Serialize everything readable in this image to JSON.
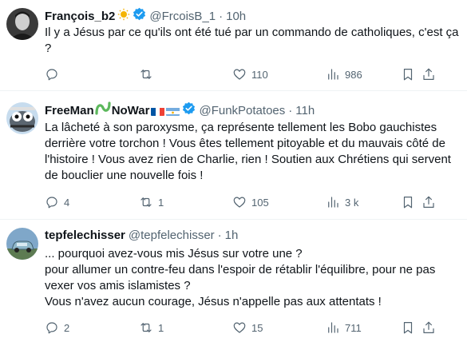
{
  "tweets": [
    {
      "name": "François_b2",
      "handle": "@FrcoisB_1",
      "time": "10h",
      "text": "Il y a Jésus par ce qu'ils ont été tué par un commando de catholiques, c'est ça ?",
      "replies": "",
      "retweets": "",
      "likes": "110",
      "views": "986",
      "badge_color": "#1d9bf0"
    },
    {
      "name": "FreeMan",
      "name_suffix": "NoWar",
      "handle": "@FunkPotatoes",
      "time": "11h",
      "text": "La lâcheté à son paroxysme, ça représente tellement les Bobo gauchistes derrière votre torchon ! Vous êtes tellement pitoyable et du mauvais côté de l'histoire ! Vous avez rien de Charlie, rien ! Soutien aux Chrétiens qui servent de bouclier une nouvelle fois !",
      "replies": "4",
      "retweets": "1",
      "likes": "105",
      "views": "3 k",
      "badge_color": "#1d9bf0"
    },
    {
      "name": "tepfelechisser",
      "handle": "@tepfelechisser",
      "time": "1h",
      "text": "... pourquoi avez-vous mis Jésus sur votre une ?\npour allumer un contre-feu dans l'espoir de rétablir l'équilibre, pour ne pas vexer vos amis islamistes ?\nVous n'avez aucun courage, Jésus n'appelle pas aux attentats !",
      "replies": "2",
      "retweets": "1",
      "likes": "15",
      "views": "711"
    }
  ],
  "separator": "·",
  "icons": [
    "reply-icon",
    "retweet-icon",
    "like-icon",
    "views-icon",
    "bookmark-icon",
    "share-icon"
  ]
}
